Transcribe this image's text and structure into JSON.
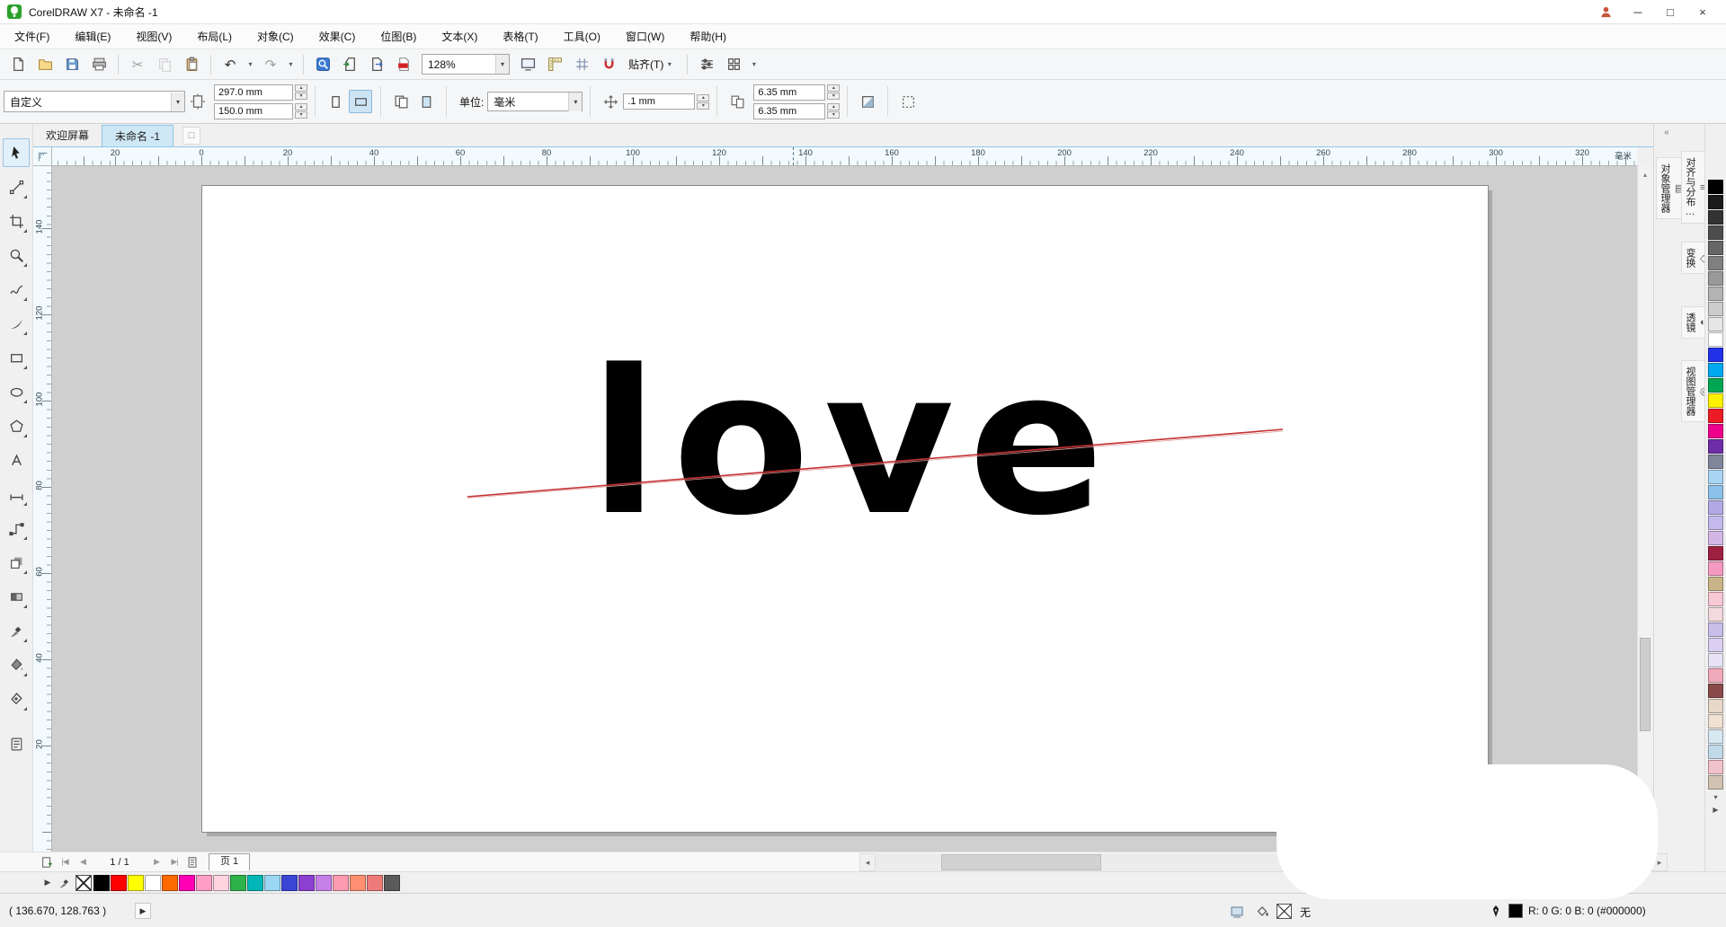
{
  "titlebar": {
    "title": "CorelDRAW X7 - 未命名 -1"
  },
  "menus": [
    "文件(F)",
    "编辑(E)",
    "视图(V)",
    "布局(L)",
    "对象(C)",
    "效果(C)",
    "位图(B)",
    "文本(X)",
    "表格(T)",
    "工具(O)",
    "窗口(W)",
    "帮助(H)"
  ],
  "toolbar": {
    "zoom_level": "128%",
    "snap_label": "贴齐(T)"
  },
  "propbar": {
    "preset": "自定义",
    "page_width": "297.0 mm",
    "page_height": "150.0 mm",
    "units_label": "单位:",
    "units_value": "毫米",
    "nudge_distance": ".1 mm",
    "duplicate_x": "6.35 mm",
    "duplicate_y": "6.35 mm"
  },
  "doc_tabs": {
    "welcome": "欢迎屏幕",
    "document": "未命名 -1"
  },
  "hruler": {
    "ticks": [
      "20",
      "0",
      "20",
      "40",
      "60",
      "80",
      "100",
      "120",
      "140",
      "160",
      "180",
      "200",
      "220",
      "240",
      "260",
      "280",
      "300",
      "320"
    ],
    "unit": "毫米"
  },
  "vruler": {
    "ticks": [
      "140",
      "120",
      "100",
      "80",
      "60",
      "40",
      "20"
    ]
  },
  "canvas": {
    "artwork_text": "love"
  },
  "pagenav": {
    "page_indicator": "1 / 1",
    "page_tab": "页 1"
  },
  "statusbar": {
    "coords": "( 136.670, 128.763 )",
    "fill_value": "无",
    "outline_value": "R: 0 G: 0 B: 0 (#000000)"
  },
  "dockers": [
    "对象管理器",
    "对齐与分布…",
    "变换",
    "透镜",
    "视图管理器"
  ],
  "icons": {
    "undo": "↶",
    "redo": "↷",
    "cut": "✂",
    "dropdown": "▾",
    "up": "▴",
    "down": "▾",
    "left": "◂",
    "right": "▸",
    "first": "|◀",
    "prev": "◀",
    "next": "▶",
    "last": "▶|",
    "play": "▶",
    "flyout": "▶",
    "collapse": "«",
    "new_tab": "□",
    "object_manager": "▤",
    "align": "≡",
    "transform": "◇",
    "lens": "◐",
    "view_manager": "◎"
  },
  "colors": {
    "artwork_text": "#000000",
    "artwork_line": "#c23232",
    "active_tab_bg": "#cfe8f6"
  },
  "palettes": {
    "bottom": [
      "#000000",
      "#ff0000",
      "#ffff00",
      "#ffffff",
      "#ff6a00",
      "#ff00b4",
      "#ff9ec4",
      "#ffd3e0",
      "#2db34a",
      "#00b7b7",
      "#9ad7f2",
      "#3a45d6",
      "#8c3fd0",
      "#c77fe8",
      "#ff9bb0",
      "#ff8f70",
      "#ef7a7a",
      "#5a5a5a"
    ],
    "right": [
      "#000000",
      "#1a1a1a",
      "#333333",
      "#4d4d4d",
      "#666666",
      "#808080",
      "#999999",
      "#b3b3b3",
      "#cccccc",
      "#e6e6e6",
      "#ffffff",
      "#2231e8",
      "#00a8ef",
      "#00a651",
      "#fff200",
      "#ed1c24",
      "#ec008c",
      "#6f2da8",
      "#7f8699",
      "#a8d5f2",
      "#8cc0e8",
      "#b2a9e4",
      "#c3b9ec",
      "#d4b6e6",
      "#9e2040",
      "#f49ac1",
      "#c9b389",
      "#f8c8d4",
      "#f2dade",
      "#c9bdea",
      "#dacff1",
      "#e9e3f8",
      "#f0aabb",
      "#8a4a4a",
      "#e8d8c8",
      "#f0e2d2",
      "#d8e8f2",
      "#c2d9ea",
      "#f2c2ca",
      "#d2c2b2"
    ]
  }
}
